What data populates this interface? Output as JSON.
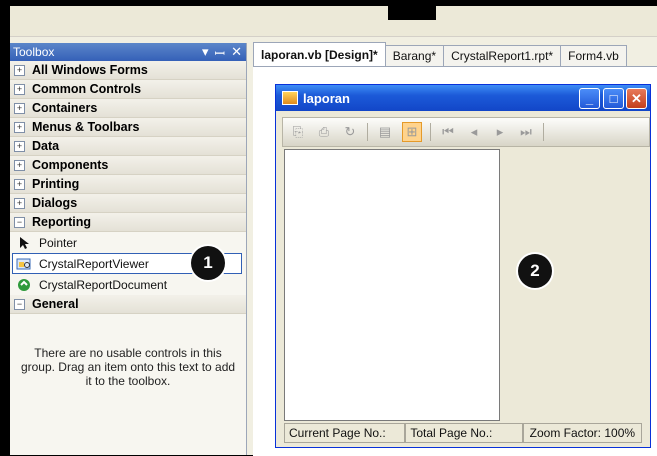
{
  "toolbox": {
    "title": "Toolbox",
    "controls": [
      "▾",
      "ꟷ",
      "✕"
    ],
    "groups": [
      {
        "label": "All Windows Forms",
        "expanded": false
      },
      {
        "label": "Common Controls",
        "expanded": false
      },
      {
        "label": "Containers",
        "expanded": false
      },
      {
        "label": "Menus & Toolbars",
        "expanded": false
      },
      {
        "label": "Data",
        "expanded": false
      },
      {
        "label": "Components",
        "expanded": false
      },
      {
        "label": "Printing",
        "expanded": false
      },
      {
        "label": "Dialogs",
        "expanded": false
      },
      {
        "label": "Reporting",
        "expanded": true
      },
      {
        "label": "General",
        "expanded": true
      }
    ],
    "reporting_items": [
      "Pointer",
      "CrystalReportViewer",
      "CrystalReportDocument"
    ],
    "general_message": "There are no usable controls in this group. Drag an item onto this text to add it to the toolbox."
  },
  "tabs": [
    "laporan.vb [Design]*",
    "Barang*",
    "CrystalReport1.rpt*",
    "Form4.vb"
  ],
  "form": {
    "title": "laporan",
    "status": [
      "Current Page No.:",
      "Total Page No.:",
      "Zoom Factor: 100%"
    ]
  },
  "callouts": [
    "1",
    "2"
  ]
}
